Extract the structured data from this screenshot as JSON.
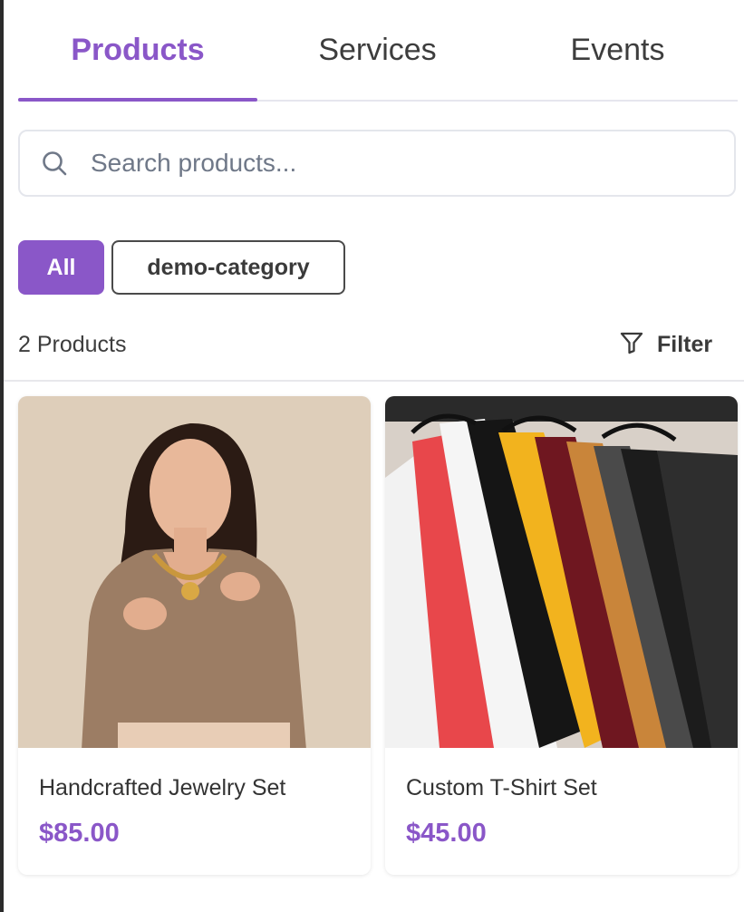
{
  "tabs": [
    {
      "label": "Products",
      "active": true
    },
    {
      "label": "Services",
      "active": false
    },
    {
      "label": "Events",
      "active": false
    }
  ],
  "search": {
    "placeholder": "Search products...",
    "value": "",
    "icon": "search-icon"
  },
  "categories": [
    {
      "label": "All",
      "selected": true
    },
    {
      "label": "demo-category",
      "selected": false
    }
  ],
  "summary": {
    "count_text": "2 Products",
    "filter_label": "Filter",
    "filter_icon": "filter-icon"
  },
  "products": [
    {
      "name": "Handcrafted Jewelry Set",
      "price": "$85.00",
      "image": "woman-wearing-jewelry-photo"
    },
    {
      "name": "Custom T-Shirt Set",
      "price": "$45.00",
      "image": "colorful-tshirts-on-rack-photo"
    }
  ],
  "colors": {
    "accent": "#8a57c8",
    "border": "#e4e6ec",
    "text": "#333333"
  }
}
